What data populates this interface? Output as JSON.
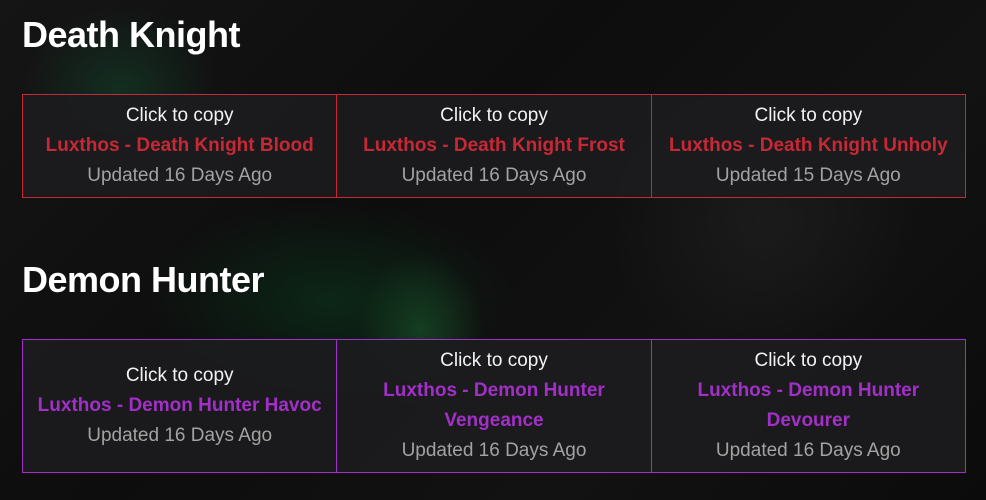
{
  "sections": [
    {
      "title": "Death Knight",
      "accent": "#c62835",
      "cards": [
        {
          "copy": "Click to copy",
          "name": "Luxthos - Death Knight Blood",
          "updated": "Updated 16 Days Ago"
        },
        {
          "copy": "Click to copy",
          "name": "Luxthos - Death Knight Frost",
          "updated": "Updated 16 Days Ago"
        },
        {
          "copy": "Click to copy",
          "name": "Luxthos - Death Knight Unholy",
          "updated": "Updated 15 Days Ago"
        }
      ]
    },
    {
      "title": "Demon Hunter",
      "accent": "#a22fc8",
      "cards": [
        {
          "copy": "Click to copy",
          "name": "Luxthos - Demon Hunter Havoc",
          "updated": "Updated 16 Days Ago"
        },
        {
          "copy": "Click to copy",
          "name": "Luxthos - Demon Hunter Vengeance",
          "updated": "Updated 16 Days Ago"
        },
        {
          "copy": "Click to copy",
          "name": "Luxthos - Demon Hunter Devourer",
          "updated": "Updated 16 Days Ago"
        }
      ]
    }
  ]
}
